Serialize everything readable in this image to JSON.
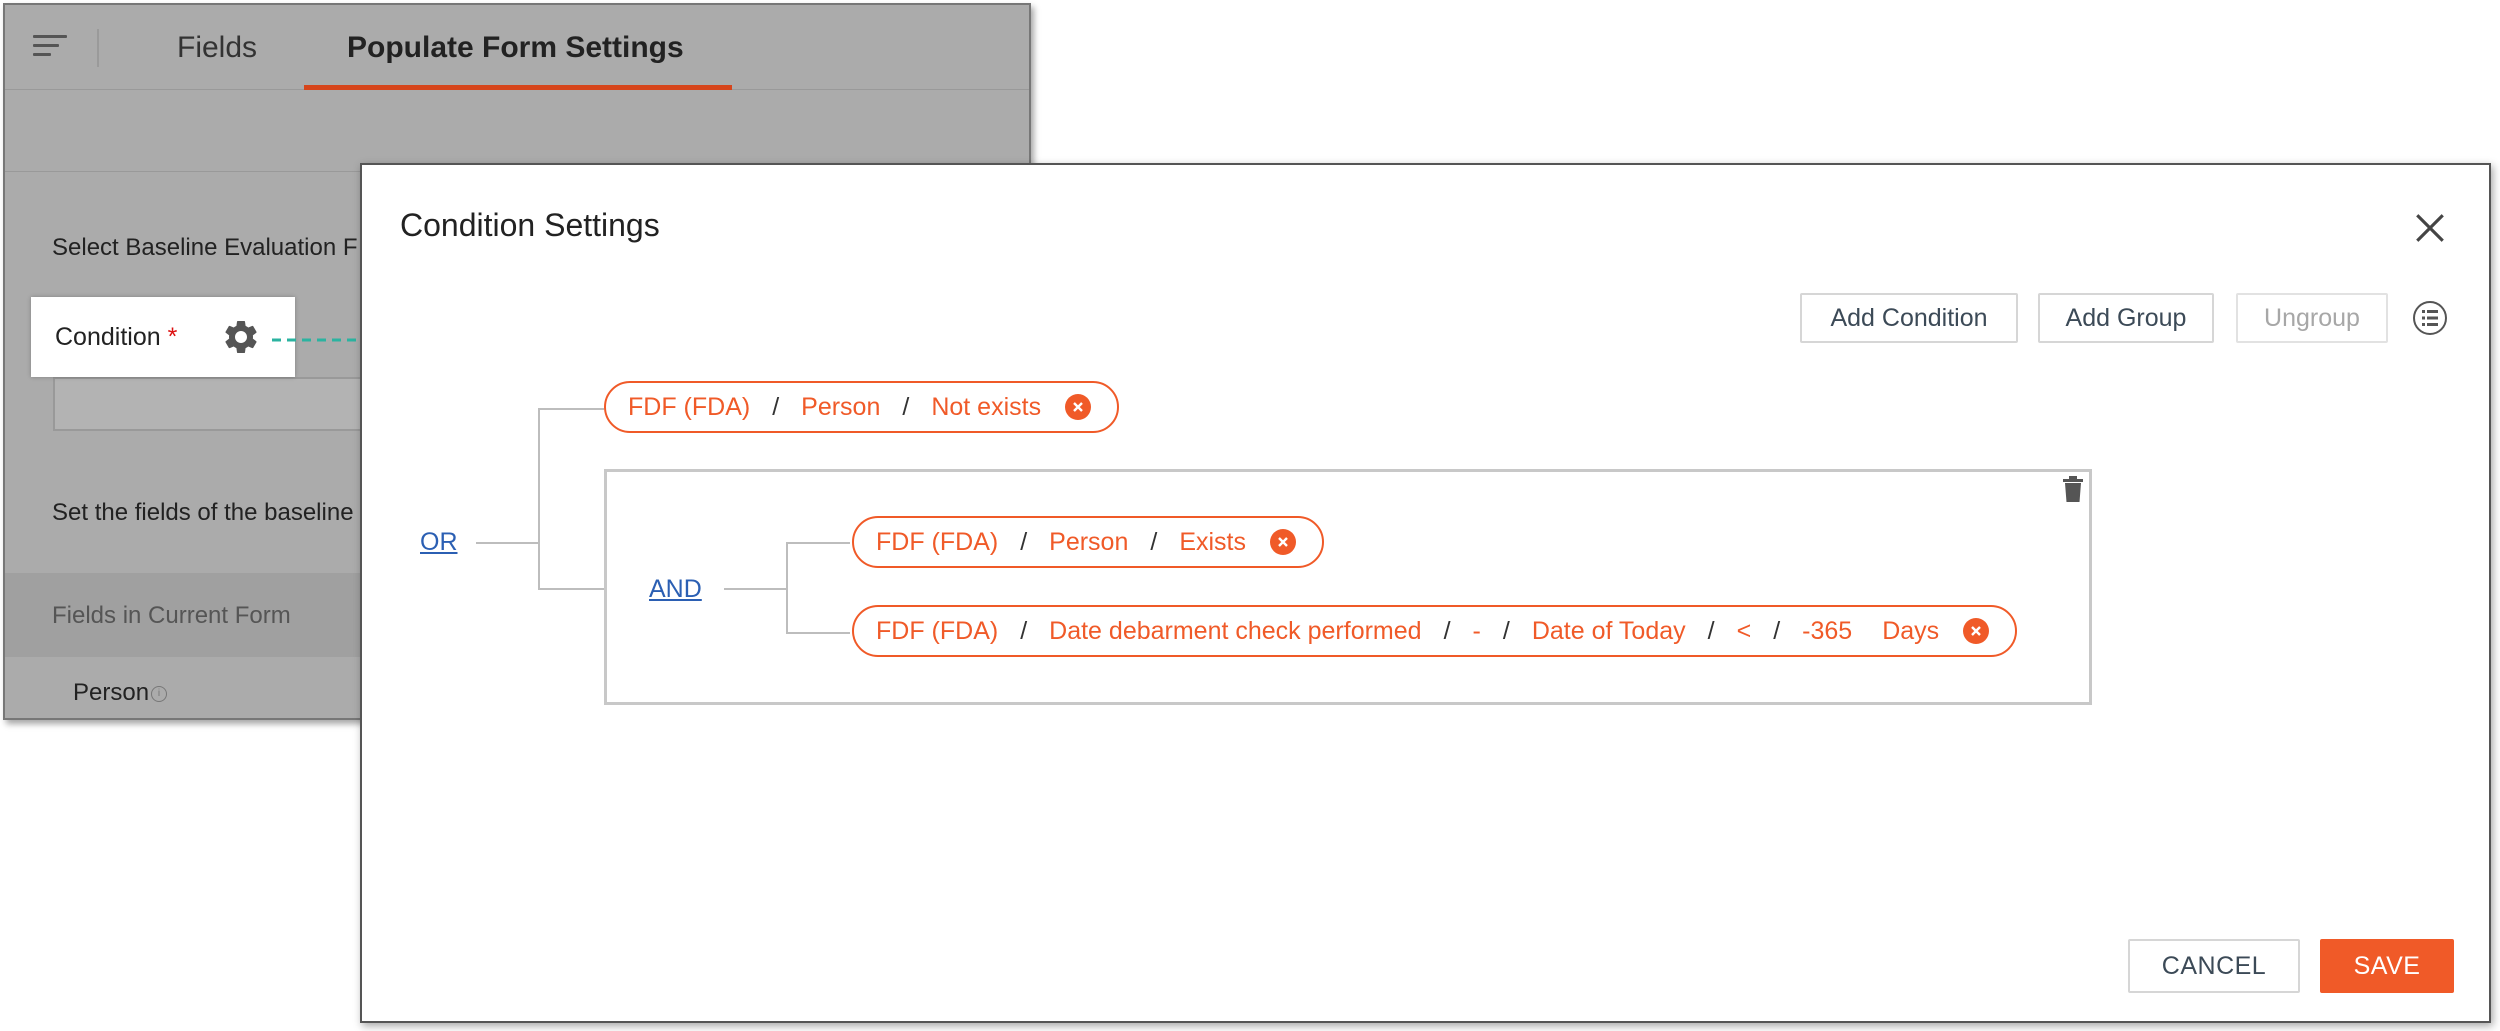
{
  "background": {
    "tabs": [
      {
        "label": "Fields"
      },
      {
        "label": "Populate Form Settings"
      }
    ],
    "select_label": "Select Baseline Evaluation F",
    "condition_label": "Condition",
    "required_mark": "*",
    "set_fields_label": "Set the fields of the baseline",
    "fields_header": "Fields in Current Form",
    "field_person": "Person",
    "info_glyph": "i"
  },
  "dialog": {
    "title": "Condition Settings",
    "toolbar": {
      "add_condition": "Add Condition",
      "add_group": "Add Group",
      "ungroup": "Ungroup"
    },
    "root_operator": "OR",
    "group_operator": "AND",
    "condition1": {
      "source": "FDF (FDA)",
      "field": "Person",
      "op": "Not exists"
    },
    "condition2": {
      "source": "FDF (FDA)",
      "field": "Person",
      "op": "Exists"
    },
    "condition3": {
      "source": "FDF (FDA)",
      "field": "Date debarment check performed",
      "modifier": "-",
      "compare_to": "Date of Today",
      "op": "<",
      "value": "-365",
      "unit": "Days"
    },
    "separator": "/",
    "cancel": "CANCEL",
    "save": "SAVE"
  },
  "colors": {
    "accent": "#f05a28",
    "tab_underline": "#d6451b",
    "link": "#2b5fb3",
    "arrow": "#2bb3a0"
  },
  "icons": [
    "menu-icon",
    "gear-icon",
    "close-icon",
    "list-settings-icon",
    "trash-icon",
    "remove-icon",
    "info-icon"
  ]
}
